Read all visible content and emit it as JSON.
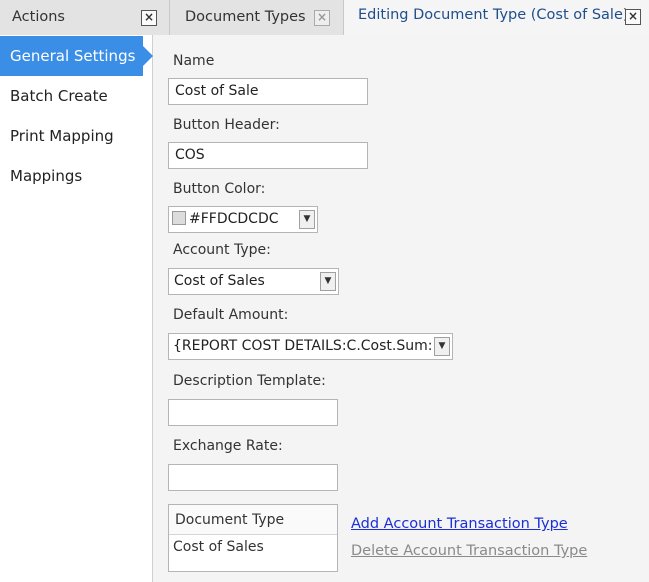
{
  "tabs": [
    {
      "label": "Actions"
    },
    {
      "label": "Document Types"
    },
    {
      "label": "Editing Document Type (Cost of Sale)"
    }
  ],
  "close_glyph": "×",
  "sidebar": {
    "items": [
      {
        "label": "General Settings",
        "selected": true
      },
      {
        "label": "Batch Create"
      },
      {
        "label": "Print Mapping"
      },
      {
        "label": "Mappings"
      }
    ]
  },
  "form": {
    "name": {
      "label": "Name",
      "value": "Cost of Sale"
    },
    "button_header": {
      "label": "Button Header:",
      "value": "COS"
    },
    "button_color": {
      "label": "Button Color:",
      "value": "#FFDCDCDC",
      "swatch": "#DCDCDC"
    },
    "account_type": {
      "label": "Account Type:",
      "value": "Cost of Sales"
    },
    "default_amount": {
      "label": "Default Amount:",
      "value": "{REPORT COST DETAILS:C.Cost.Sum:}"
    },
    "description_template": {
      "label": "Description Template:",
      "value": ""
    },
    "exchange_rate": {
      "label": "Exchange Rate:",
      "value": ""
    }
  },
  "transactions": {
    "header": "Document Type",
    "rows": [
      "Cost of Sales"
    ],
    "add_label": "Add Account Transaction Type",
    "delete_label": "Delete Account Transaction Type"
  },
  "colors": {
    "accent": "#3A8EE6",
    "link": "#1A2FD6",
    "link_disabled": "#8A8A8A"
  },
  "icons": {
    "close": "close-icon",
    "dropdown": "chevron-down-icon"
  }
}
